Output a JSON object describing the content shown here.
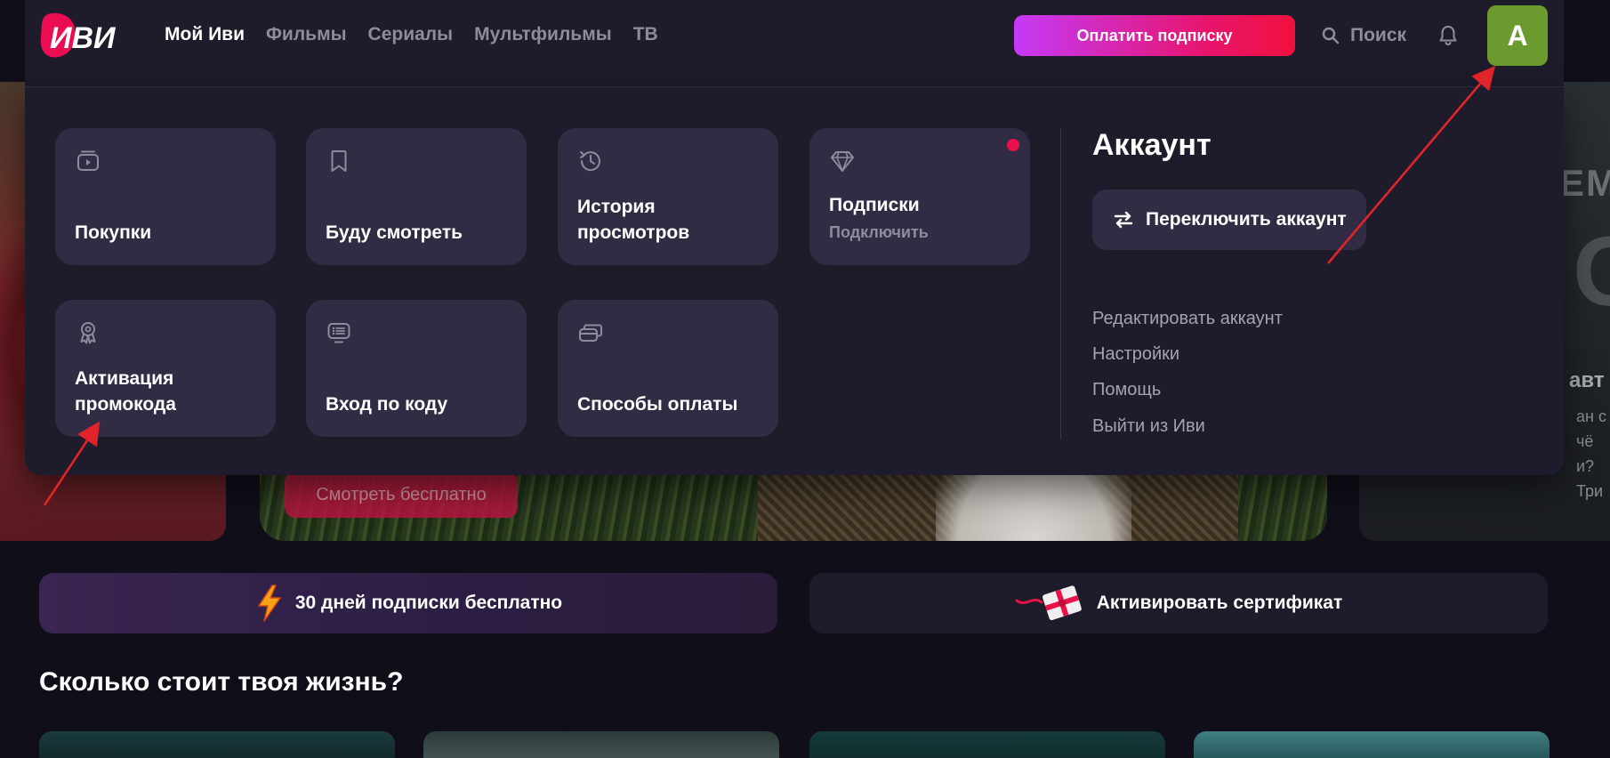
{
  "header": {
    "logo_text": "ИВИ",
    "nav": [
      "Мой Иви",
      "Фильмы",
      "Сериалы",
      "Мультфильмы",
      "ТВ"
    ],
    "pay_button": "Оплатить подписку",
    "search_label": "Поиск",
    "avatar_letter": "A"
  },
  "menu": {
    "tiles": [
      {
        "label": "Покупки",
        "icon": "purchases-icon"
      },
      {
        "label": "Буду смотреть",
        "icon": "bookmark-icon"
      },
      {
        "label": "История просмотров",
        "icon": "history-icon"
      },
      {
        "label": "Подписки",
        "sub": "Подключить",
        "icon": "diamond-icon"
      },
      {
        "label": "Активация промокода",
        "icon": "award-icon"
      },
      {
        "label": "Вход по коду",
        "icon": "tv-code-icon"
      },
      {
        "label": "Способы оплаты",
        "icon": "cards-icon"
      }
    ],
    "account": {
      "title": "Аккаунт",
      "switch_label": "Переключить аккаунт",
      "links": [
        "Редактировать аккаунт",
        "Настройки",
        "Помощь",
        "Выйти из Иви"
      ]
    }
  },
  "hero": {
    "watch_free": "Смотреть бесплатно",
    "right_fragments": [
      "ЕМ",
      "О",
      "авт",
      "ан с чё",
      "и? Три"
    ]
  },
  "promos": {
    "free_days": "30 дней подписки бесплатно",
    "certificate": "Активировать сертификат"
  },
  "section_title": "Сколько стоит твоя жизнь?",
  "colors": {
    "background": "#100e19",
    "panel": "#1e1b2b",
    "tile": "#312c44",
    "accent_gradient_start": "#c53af7",
    "accent_gradient_end": "#f1103d",
    "avatar": "#6b9b2e",
    "notification_dot": "#ea1149",
    "annotation_arrow": "#e0242a"
  }
}
